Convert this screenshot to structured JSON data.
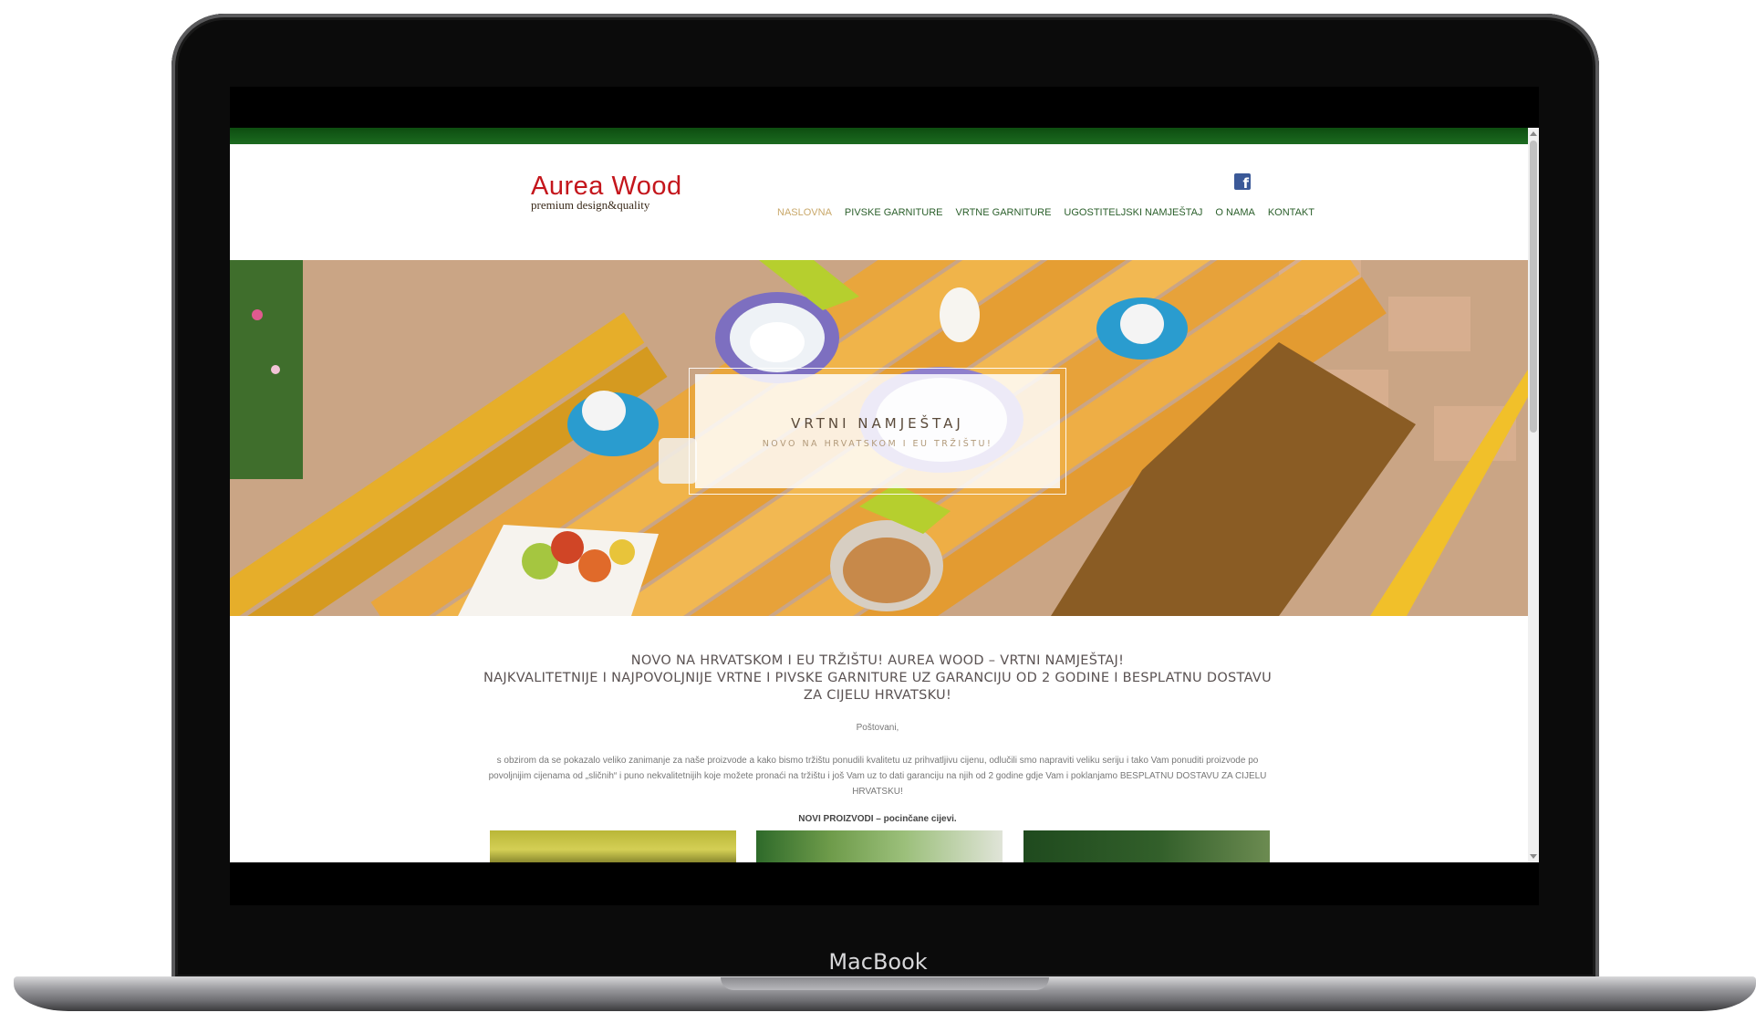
{
  "device": {
    "brand_label": "MacBook"
  },
  "site": {
    "logo_name": "Aurea Wood",
    "logo_tagline": "premium design&quality",
    "social_icon": "facebook-icon",
    "nav": [
      {
        "label": "NASLOVNA",
        "active": true
      },
      {
        "label": "PIVSKE GARNITURE",
        "active": false
      },
      {
        "label": "VRTNE GARNITURE",
        "active": false
      },
      {
        "label": "UGOSTITELJSKI NAMJEŠTAJ",
        "active": false
      },
      {
        "label": "O NAMA",
        "active": false
      },
      {
        "label": "KONTAKT",
        "active": false
      }
    ],
    "colors": {
      "top_bar": "#1c6b20",
      "logo": "#c4161c",
      "nav": "#2b5f2b",
      "nav_active": "#c9a86a"
    }
  },
  "hero": {
    "title": "VRTNI NAMJEŠTAJ",
    "subtitle": "NOVO NA HRVATSKOM I EU TRŽIŠTU!"
  },
  "content": {
    "headline_line1": "NOVO NA HRVATSKOM I EU TRŽIŠTU! AUREA WOOD – VRTNI NAMJEŠTAJ!",
    "headline_line2": "NAJKVALITETNIJE I NAJPOVOLJNIJE VRTNE I PIVSKE GARNITURE UZ GARANCIJU OD 2 GODINE I BESPLATNU DOSTAVU",
    "headline_line3": "ZA CIJELU HRVATSKU!",
    "greeting": "Poštovani,",
    "paragraph": "s obzirom da se pokazalo veliko zanimanje za naše proizvode a kako bismo tržištu ponudili kvalitetu uz prihvatljivu cijenu, odlučili smo napraviti veliku seriju i tako Vam ponuditi proizvode po povoljnijim cijenama od „sličnih“ i puno nekvalitetnijih koje možete pronaći na tržištu i još Vam uz to dati garanciju na njih od 2 godine gdje Vam i poklanjamo BESPLATNU DOSTAVU ZA CIJELU HRVATSKU!",
    "new_products": "NOVI PROIZVODI – pocinčane cijevi."
  }
}
